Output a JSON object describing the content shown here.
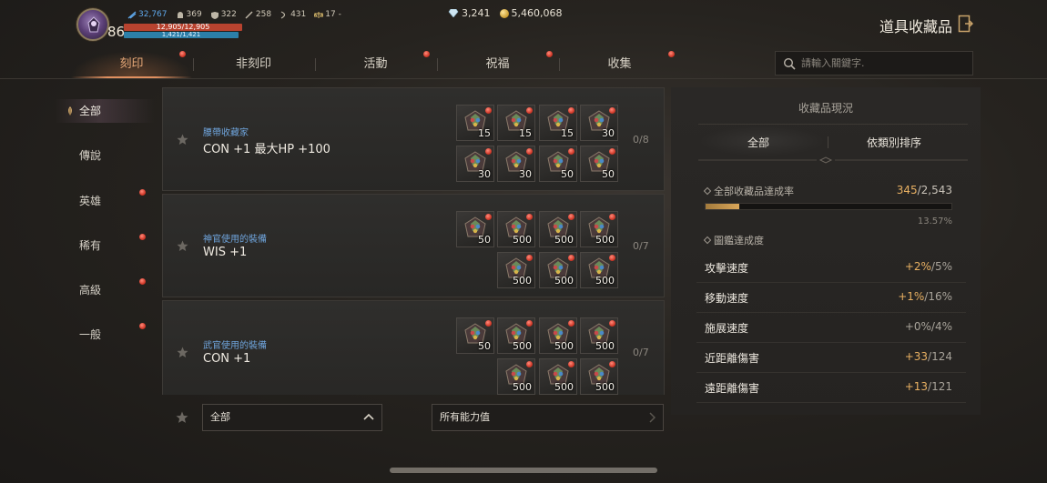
{
  "player": {
    "level": "86",
    "stats": [
      {
        "icon": "power-icon",
        "value": "32,767"
      },
      {
        "icon": "helmet-icon",
        "value": "369"
      },
      {
        "icon": "shield-icon",
        "value": "322"
      },
      {
        "icon": "sword-icon",
        "value": "258"
      },
      {
        "icon": "bow-icon",
        "value": "431"
      },
      {
        "icon": "scales-icon",
        "value": "17 -"
      }
    ],
    "hp": "12,905/12,905",
    "mp": "1,421/1,421"
  },
  "currency": {
    "diamonds": "3,241",
    "gold": "5,460,068"
  },
  "header": {
    "title": "道具收藏品"
  },
  "tabs": [
    {
      "label": "刻印",
      "active": true
    },
    {
      "label": "非刻印",
      "active": false
    },
    {
      "label": "活動",
      "active": false
    },
    {
      "label": "祝福",
      "active": false
    },
    {
      "label": "收集",
      "active": false
    }
  ],
  "search": {
    "placeholder": "請輸入關鍵字."
  },
  "categories": [
    {
      "label": "全部",
      "active": true
    },
    {
      "label": "傳說",
      "active": false
    },
    {
      "label": "英雄",
      "active": false
    },
    {
      "label": "稀有",
      "active": false
    },
    {
      "label": "高級",
      "active": false
    },
    {
      "label": "一般",
      "active": false
    }
  ],
  "collections": [
    {
      "name": "腰帶收藏家",
      "effect": "CON +1 最大HP +100",
      "progress": "0/8",
      "row1": [
        "15",
        "15",
        "15",
        "30"
      ],
      "row2": [
        "30",
        "30",
        "50",
        "50"
      ]
    },
    {
      "name": "神官使用的裝備",
      "effect": "WIS +1",
      "progress": "0/7",
      "row1": [
        "50",
        "500",
        "500",
        "500"
      ],
      "row2": [
        "500",
        "500",
        "500"
      ]
    },
    {
      "name": "武官使用的裝備",
      "effect": "CON +1",
      "progress": "0/7",
      "row1": [
        "50",
        "500",
        "500",
        "500"
      ],
      "row2": [
        "500",
        "500",
        "500"
      ]
    }
  ],
  "filters": {
    "grade": "全部",
    "ability": "所有能力值"
  },
  "panel": {
    "title": "收藏品現況",
    "tab_all": "全部",
    "tab_sort": "依類別排序",
    "rate_label": "全部收藏品達成率",
    "rate_done": "345",
    "rate_total": "/2,543",
    "rate_percent": "13.57%",
    "rate_fraction": 0.1357,
    "book_label": "圖鑑達成度",
    "bonuses": [
      {
        "label": "攻擊速度",
        "gain": "+2%",
        "total": "/5%"
      },
      {
        "label": "移動速度",
        "gain": "+1%",
        "total": "/16%"
      },
      {
        "label": "施展速度",
        "gain": "+0%",
        "total": "/4%"
      },
      {
        "label": "近距離傷害",
        "gain": "+33",
        "total": "/124"
      },
      {
        "label": "遠距離傷害",
        "gain": "+13",
        "total": "/121"
      }
    ]
  },
  "colors": {
    "accent": "#e09060",
    "gold_text": "#e8b062",
    "link_blue": "#6fa4dc",
    "red_dot": "#d23a2a"
  }
}
